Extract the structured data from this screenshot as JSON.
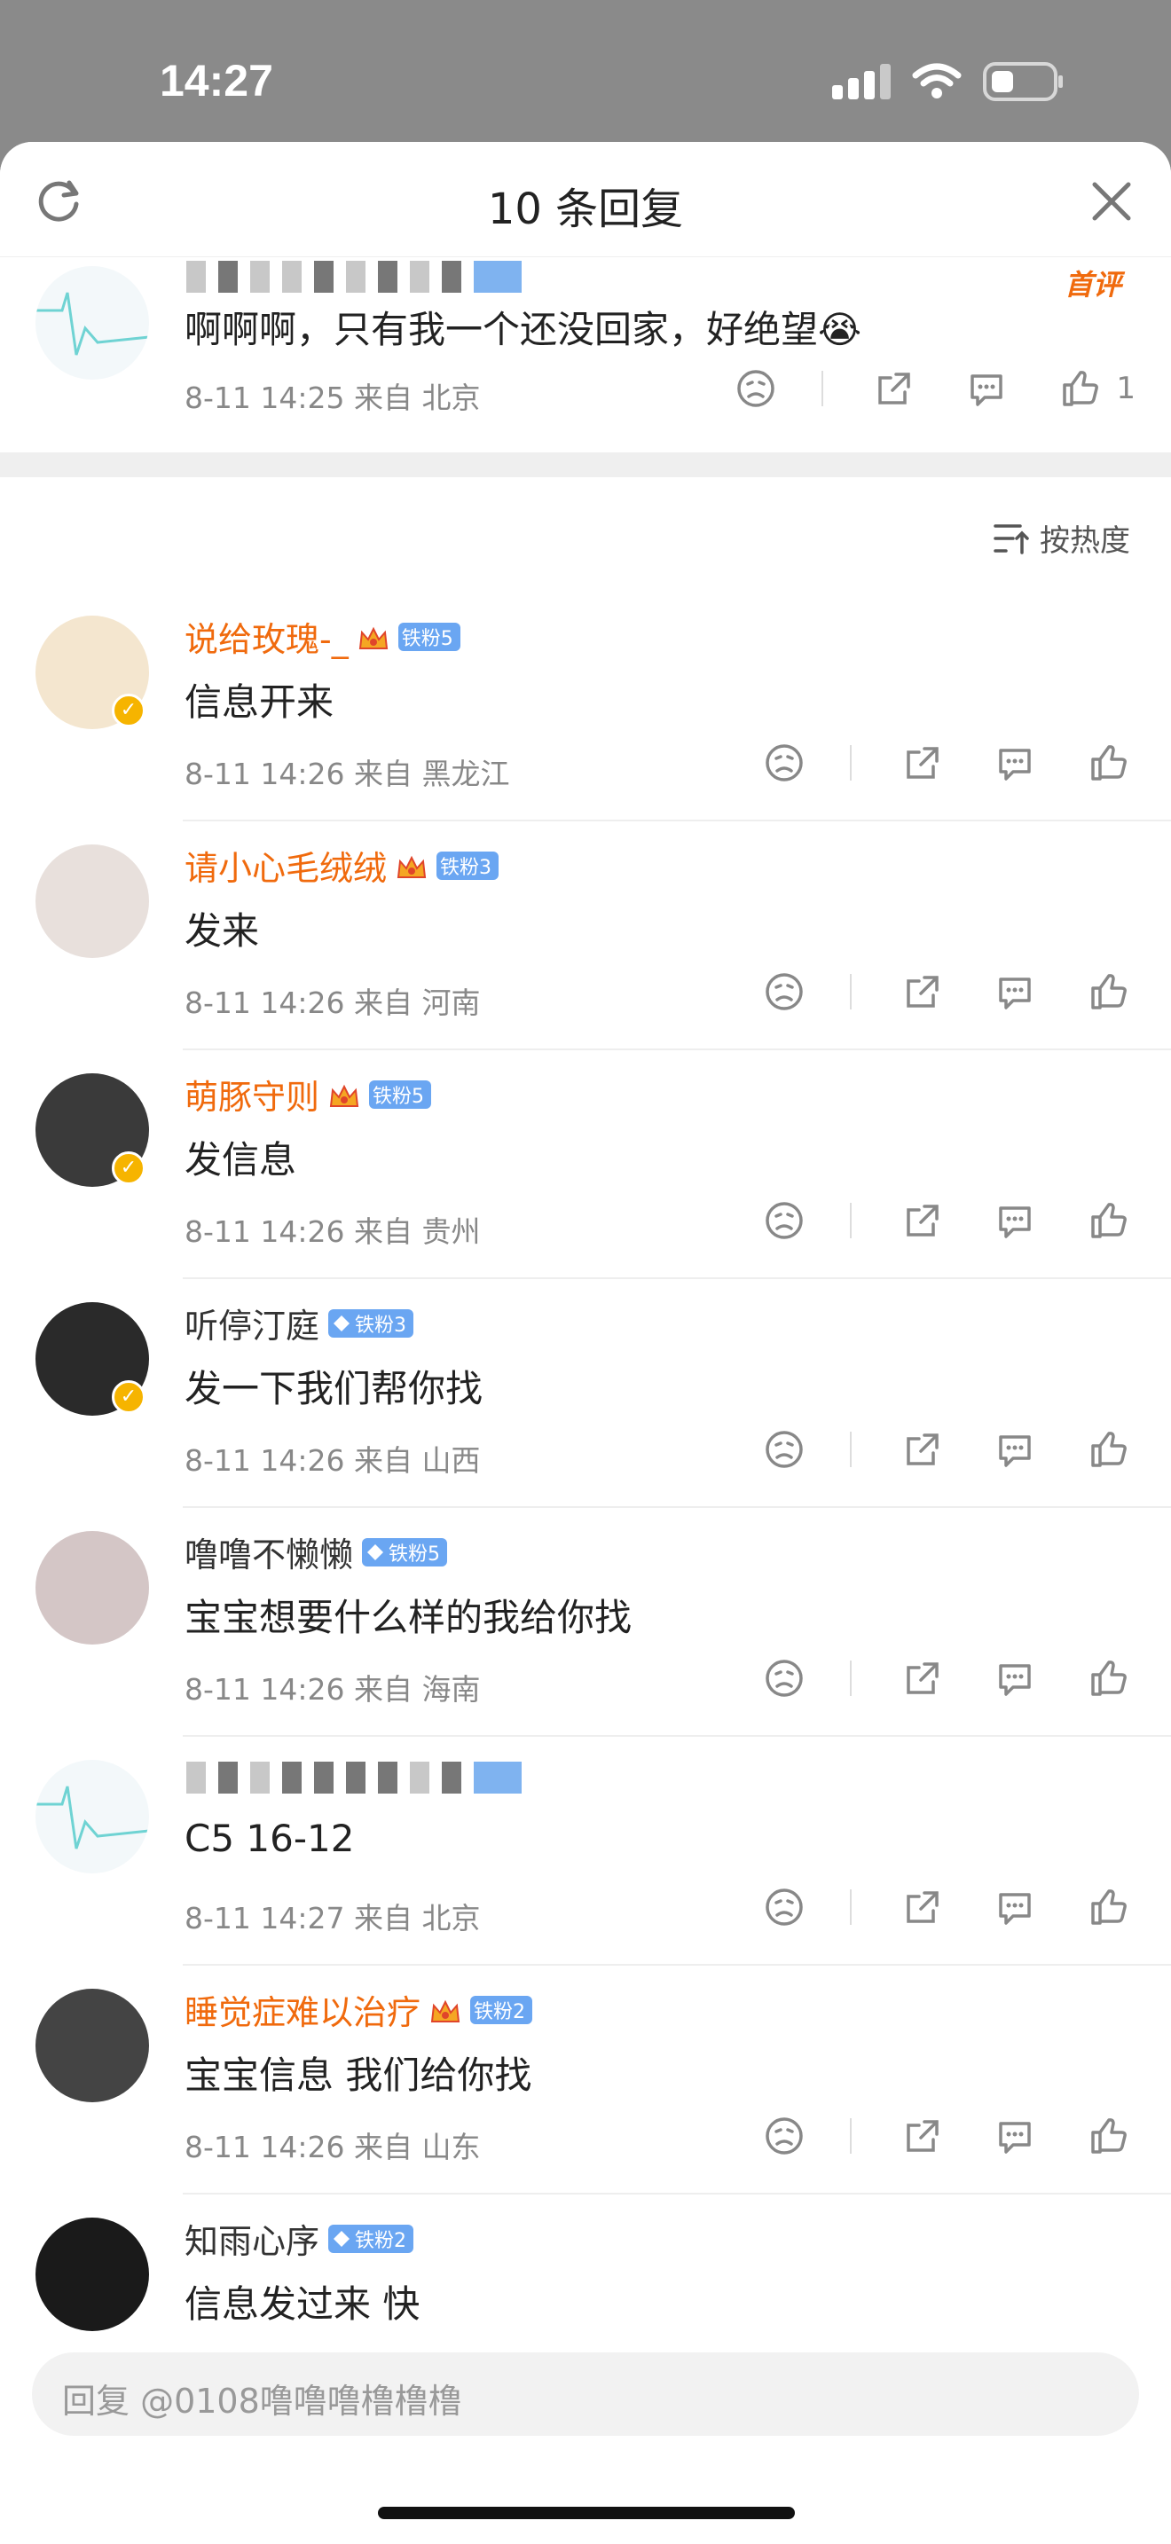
{
  "status": {
    "time": "14:27"
  },
  "header": {
    "title": "10 条回复"
  },
  "root": {
    "text": "啊啊啊，只有我一个还没回家，好绝望😭",
    "meta": "8-11 14:25 来自 北京",
    "tag": "首评",
    "like_count": "1"
  },
  "sort": {
    "label": "按热度"
  },
  "comments": [
    {
      "name": "说给玫瑰-_",
      "badge": "铁粉5",
      "text": "信息开来",
      "meta": "8-11 14:26 来自 黑龙江"
    },
    {
      "name": "请小心毛绒绒",
      "badge": "铁粉3",
      "text": "发来",
      "meta": "8-11 14:26 来自 河南"
    },
    {
      "name": "萌豚守则",
      "badge": "铁粉5",
      "text": "发信息",
      "meta": "8-11 14:26 来自 贵州"
    },
    {
      "name": "听停汀庭",
      "badge": "铁粉3",
      "text": "发一下我们帮你找",
      "meta": "8-11 14:26 来自 山西"
    },
    {
      "name": "噜噜不懒懒",
      "badge": "铁粉5",
      "text": "宝宝想要什么样的我给你找",
      "meta": "8-11 14:26 来自 海南"
    },
    {
      "name": "",
      "badge": "",
      "text": "C5 16-12",
      "meta": "8-11 14:27 来自 北京"
    },
    {
      "name": "睡觉症难以治疗",
      "badge": "铁粉2",
      "text": "宝宝信息 我们给你找",
      "meta": "8-11 14:26 来自 山东"
    },
    {
      "name": "知雨心序",
      "badge": "铁粉2",
      "text": "信息发过来 快",
      "meta": ""
    }
  ],
  "reply": {
    "placeholder": "回复 @0108噜噜噜橹橹橹"
  },
  "colors": {
    "orange_name": "#f06a0d",
    "fan_badge": "#6aa6f2",
    "divider": "#eeeeee"
  },
  "icons": [
    "refresh-icon",
    "close-icon",
    "dislike-icon",
    "share-icon",
    "comment-icon",
    "like-icon",
    "sort-icon",
    "crown-icon",
    "diamond-icon",
    "verified-icon"
  ]
}
